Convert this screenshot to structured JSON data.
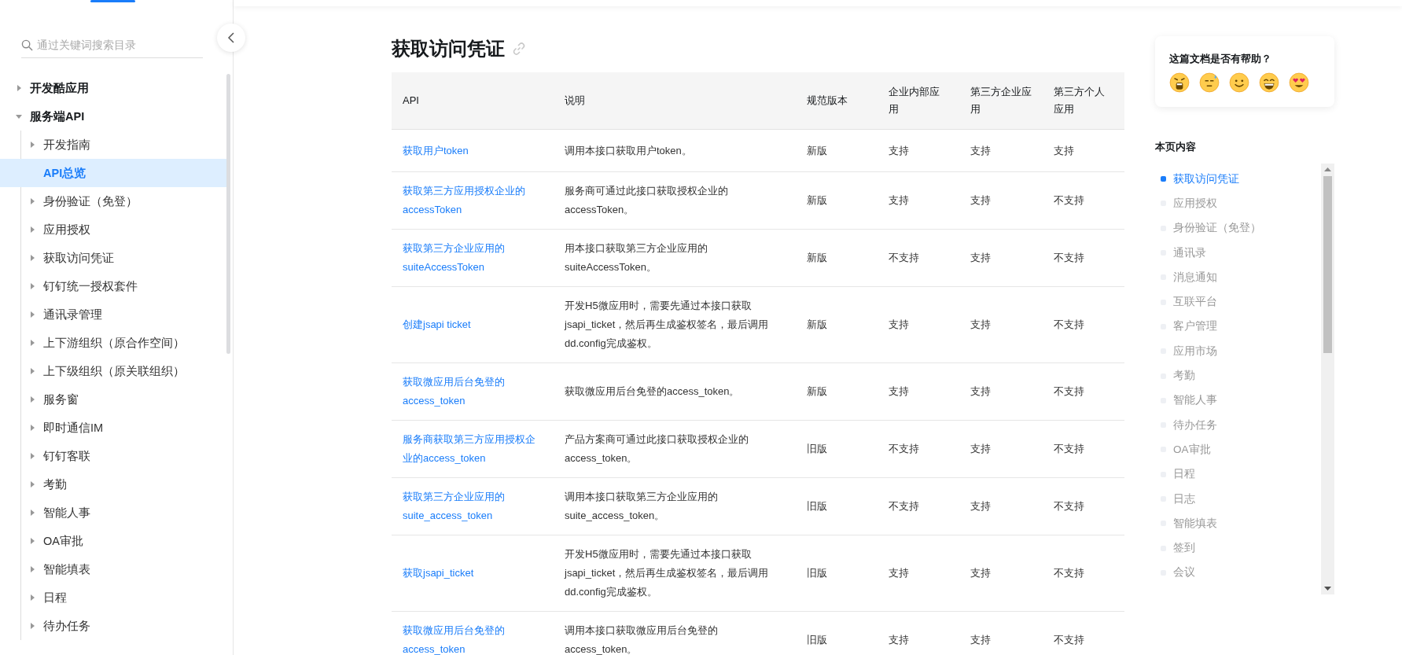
{
  "sidebar": {
    "search": {
      "placeholder": "通过关键词搜索目录"
    },
    "items": [
      {
        "label": "开发酷应用",
        "expanded": false,
        "selected": false
      },
      {
        "label": "服务端API",
        "expanded": true,
        "selected": false,
        "children": [
          {
            "label": "开发指南",
            "expanded": false,
            "selected": false
          },
          {
            "label": "API总览",
            "selected": true
          },
          {
            "label": "身份验证（免登）",
            "expanded": false,
            "selected": false
          },
          {
            "label": "应用授权",
            "expanded": false,
            "selected": false
          },
          {
            "label": "获取访问凭证",
            "expanded": false,
            "selected": false
          },
          {
            "label": "钉钉统一授权套件",
            "expanded": false,
            "selected": false
          },
          {
            "label": "通讯录管理",
            "expanded": false,
            "selected": false
          },
          {
            "label": "上下游组织（原合作空间）",
            "expanded": false,
            "selected": false
          },
          {
            "label": "上下级组织（原关联组织）",
            "expanded": false,
            "selected": false
          },
          {
            "label": "服务窗",
            "expanded": false,
            "selected": false
          },
          {
            "label": "即时通信IM",
            "expanded": false,
            "selected": false
          },
          {
            "label": "钉钉客联",
            "expanded": false,
            "selected": false
          },
          {
            "label": "考勤",
            "expanded": false,
            "selected": false
          },
          {
            "label": "智能人事",
            "expanded": false,
            "selected": false
          },
          {
            "label": "OA审批",
            "expanded": false,
            "selected": false
          },
          {
            "label": "智能填表",
            "expanded": false,
            "selected": false
          },
          {
            "label": "日程",
            "expanded": false,
            "selected": false
          },
          {
            "label": "待办任务",
            "expanded": false,
            "selected": false
          }
        ]
      }
    ]
  },
  "section": {
    "title": "获取访问凭证",
    "table": {
      "columns": [
        "API",
        "说明",
        "规范版本",
        "企业内部应用",
        "第三方企业应用",
        "第三方个人应用"
      ],
      "rows": [
        [
          "获取用户token",
          "调用本接口获取用户token。",
          "新版",
          "支持",
          "支持",
          "支持"
        ],
        [
          "获取第三方应用授权企业的accessToken",
          "服务商可通过此接口获取授权企业的accessToken。",
          "新版",
          "支持",
          "支持",
          "不支持"
        ],
        [
          "获取第三方企业应用的suiteAccessToken",
          "用本接口获取第三方企业应用的suiteAccessToken。",
          "新版",
          "不支持",
          "支持",
          "不支持"
        ],
        [
          "创建jsapi ticket",
          "开发H5微应用时，需要先通过本接口获取jsapi_ticket，然后再生成鉴权签名，最后调用dd.config完成鉴权。",
          "新版",
          "支持",
          "支持",
          "不支持"
        ],
        [
          "获取微应用后台免登的access_token",
          "获取微应用后台免登的access_token。",
          "新版",
          "支持",
          "支持",
          "不支持"
        ],
        [
          "服务商获取第三方应用授权企业的access_token",
          "产品方案商可通过此接口获取授权企业的access_token。",
          "旧版",
          "不支持",
          "支持",
          "不支持"
        ],
        [
          "获取第三方企业应用的suite_access_token",
          "调用本接口获取第三方企业应用的suite_access_token。",
          "旧版",
          "不支持",
          "支持",
          "不支持"
        ],
        [
          "获取jsapi_ticket",
          "开发H5微应用时，需要先通过本接口获取jsapi_ticket，然后再生成鉴权签名，最后调用dd.config完成鉴权。",
          "旧版",
          "支持",
          "支持",
          "不支持"
        ],
        [
          "获取微应用后台免登的access_token",
          "调用本接口获取微应用后台免登的access_token。",
          "旧版",
          "支持",
          "支持",
          "不支持"
        ]
      ]
    }
  },
  "feedback": {
    "question": "这篇文档是否有帮助？",
    "ratings": [
      {
        "kind": "angry"
      },
      {
        "kind": "sweat"
      },
      {
        "kind": "smile"
      },
      {
        "kind": "grin"
      },
      {
        "kind": "love"
      }
    ]
  },
  "toc": {
    "title": "本页内容",
    "items": [
      {
        "label": "获取访问凭证",
        "selected": true
      },
      {
        "label": "应用授权",
        "selected": false
      },
      {
        "label": "身份验证（免登）",
        "selected": false
      },
      {
        "label": "通讯录",
        "selected": false
      },
      {
        "label": "消息通知",
        "selected": false
      },
      {
        "label": "互联平台",
        "selected": false
      },
      {
        "label": "客户管理",
        "selected": false
      },
      {
        "label": "应用市场",
        "selected": false
      },
      {
        "label": "考勤",
        "selected": false
      },
      {
        "label": "智能人事",
        "selected": false
      },
      {
        "label": "待办任务",
        "selected": false
      },
      {
        "label": "OA审批",
        "selected": false
      },
      {
        "label": "日程",
        "selected": false
      },
      {
        "label": "日志",
        "selected": false
      },
      {
        "label": "智能填表",
        "selected": false
      },
      {
        "label": "签到",
        "selected": false
      },
      {
        "label": "会议",
        "selected": false
      }
    ]
  }
}
